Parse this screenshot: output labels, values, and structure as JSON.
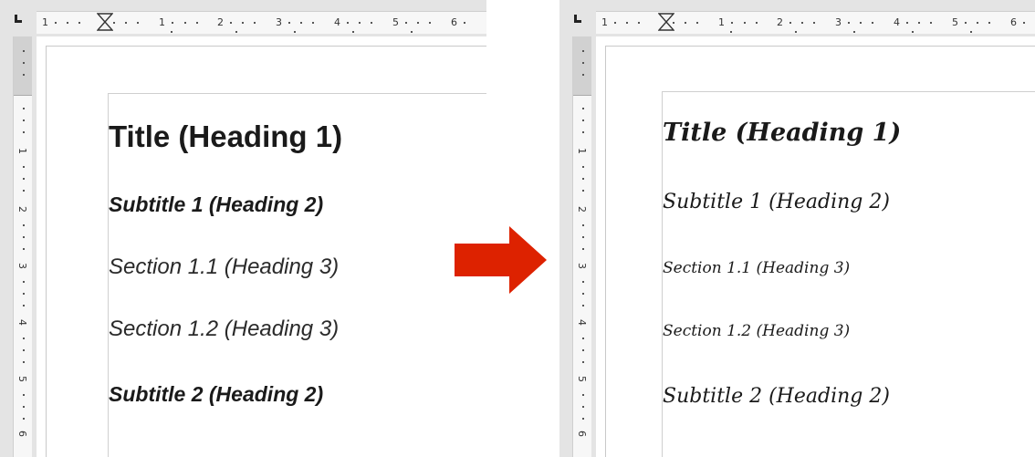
{
  "before": {
    "headings": [
      {
        "text": "Title (Heading 1)",
        "level": "Heading 1"
      },
      {
        "text": "Subtitle 1 (Heading 2)",
        "level": "Heading 2"
      },
      {
        "text": "Section 1.1 (Heading 3)",
        "level": "Heading 3"
      },
      {
        "text": "Section 1.2 (Heading 3)",
        "level": "Heading 3"
      },
      {
        "text": "Subtitle 2 (Heading 2)",
        "level": "Heading 2"
      }
    ]
  },
  "after": {
    "headings": [
      {
        "text": "Title (Heading 1)",
        "level": "Heading 1"
      },
      {
        "text": "Subtitle 1 (Heading 2)",
        "level": "Heading 2"
      },
      {
        "text": "Section 1.1 (Heading 3)",
        "level": "Heading 3"
      },
      {
        "text": "Section 1.2 (Heading 3)",
        "level": "Heading 3"
      },
      {
        "text": "Subtitle 2 (Heading 2)",
        "level": "Heading 2"
      }
    ]
  },
  "ruler": {
    "left_h_labels": [
      "1",
      "1",
      "2",
      "3",
      "4",
      "5",
      "6"
    ],
    "right_h_labels": [
      "1",
      "1",
      "2",
      "3",
      "4",
      "5",
      "6"
    ],
    "v_labels": [
      "1",
      "2",
      "3",
      "4",
      "5",
      "6"
    ],
    "tab_icon": "left-tab-stop-icon",
    "indent_icon": "hourglass-indent-marker-icon"
  },
  "arrow": {
    "icon": "right-arrow-icon",
    "color": "#dd2200"
  },
  "colors": {
    "ruler_bg": "#e4e4e4",
    "page_border": "#c9c9c9",
    "text": "#1a1a1a"
  }
}
